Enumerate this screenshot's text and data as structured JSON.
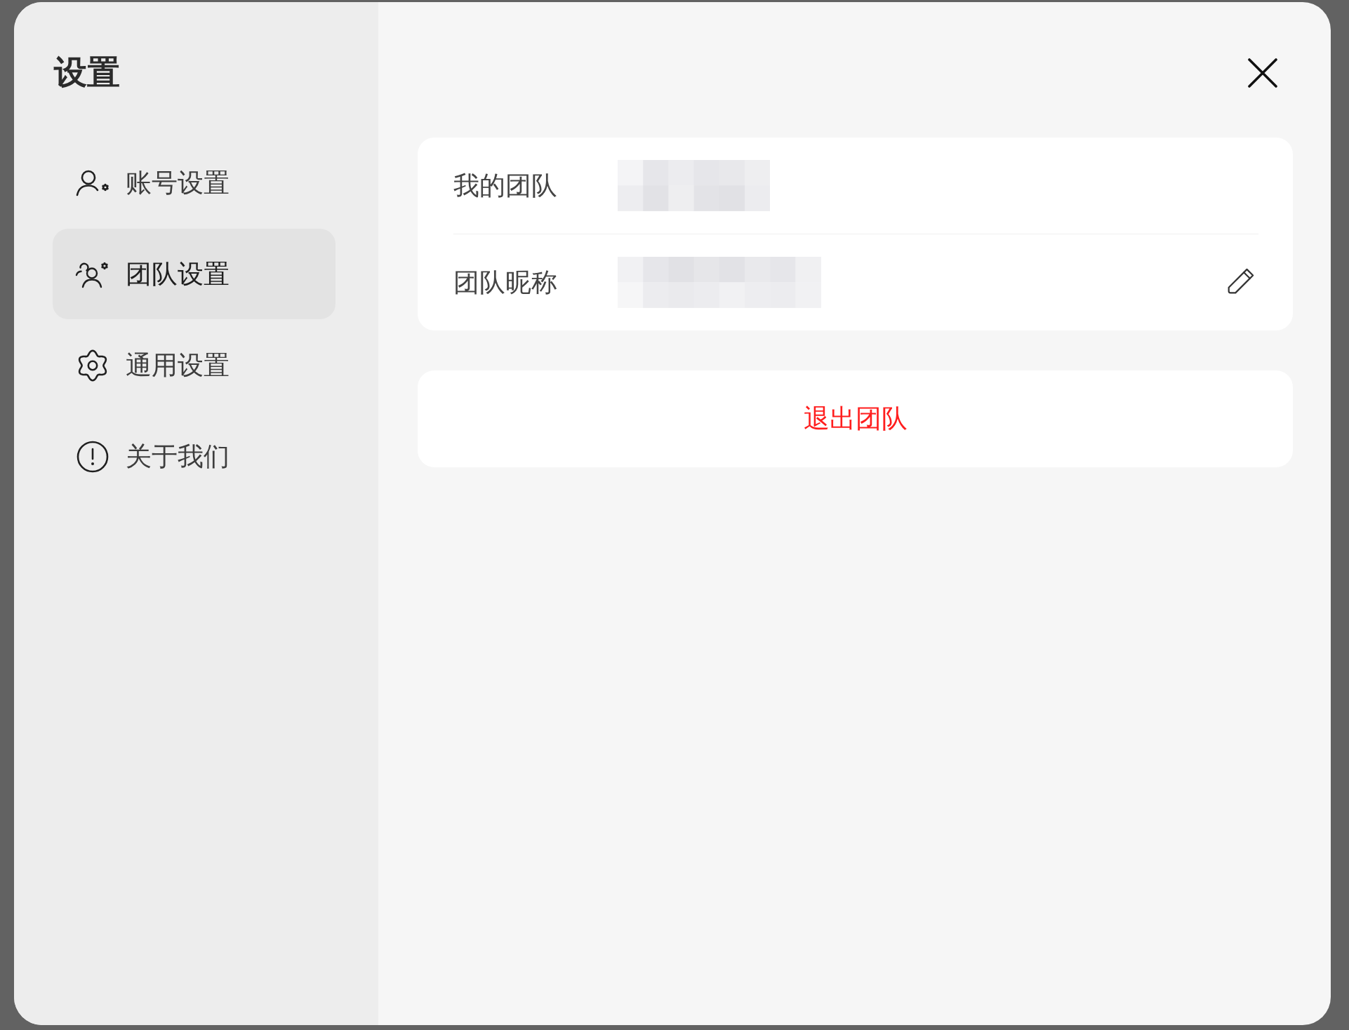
{
  "sidebar": {
    "title": "设置",
    "items": [
      {
        "kind": "account",
        "label": "账号设置",
        "selected": false
      },
      {
        "kind": "team",
        "label": "团队设置",
        "selected": true
      },
      {
        "kind": "general",
        "label": "通用设置",
        "selected": false
      },
      {
        "kind": "about",
        "label": "关于我们",
        "selected": false
      }
    ]
  },
  "team_info": {
    "rows": [
      {
        "label": "我的团队",
        "redacted": true,
        "editable": false
      },
      {
        "label": "团队昵称",
        "redacted": true,
        "editable": true
      }
    ]
  },
  "leave_button": {
    "label": "退出团队"
  }
}
